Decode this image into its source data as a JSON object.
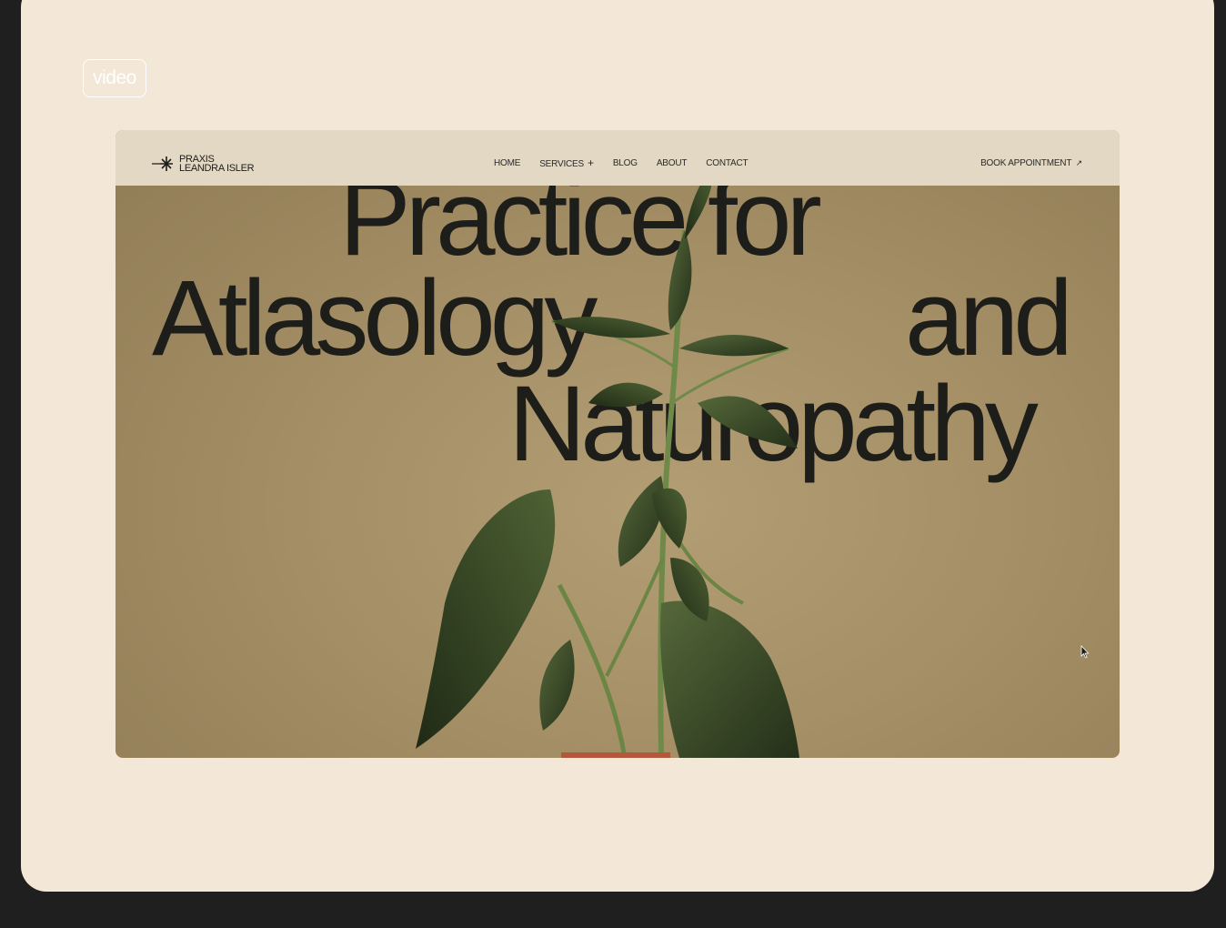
{
  "badge": {
    "label": "video"
  },
  "site": {
    "logo_line1": "PRAXIS",
    "logo_line2": "LEANDRA ISLER",
    "nav": [
      "HOME",
      "SERVICES",
      "BLOG",
      "ABOUT",
      "CONTACT"
    ],
    "nav_services_suffix": "+",
    "cta": "BOOK APPOINTMENT",
    "cta_icon": "↗"
  },
  "hero": {
    "line1": "Practice for",
    "line2a": "Atlasology",
    "line2b": "and",
    "line3": "Naturopathy"
  },
  "colors": {
    "card_bg": "#f3e8d7",
    "page_bg": "#1f1f1f",
    "nav_bg": "#e3d8c4",
    "hero_bg": "#a58f66",
    "leaf_green": "#3a4a25"
  },
  "icons": [
    "logo-asterisk-icon",
    "arrow-up-right-icon",
    "cursor-icon"
  ]
}
